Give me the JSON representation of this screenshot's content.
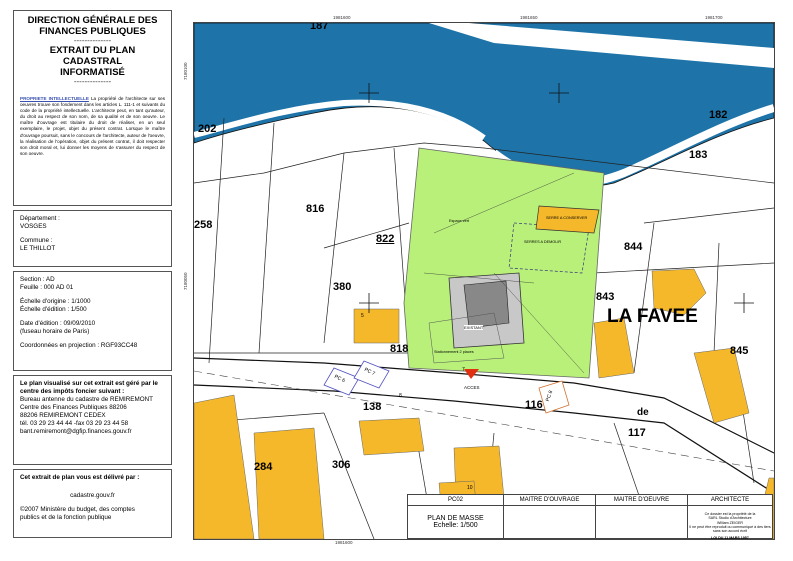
{
  "sidebar": {
    "header": {
      "line1": "DIRECTION GÉNÉRALE DES",
      "line2": "FINANCES PUBLIQUES",
      "dash": "--------------",
      "line3": "EXTRAIT DU PLAN CADASTRAL",
      "line4": "INFORMATISÉ",
      "dash2": "--------------"
    },
    "property": {
      "title": "PROPRIETE INTELLECTUELLE",
      "text": "La propriété de l'architecte sur ses oeuvres trouve son fondement dans les articles L. 111-1 et suivants du code de la propriété intellectuelle. L'architecte peut, en tant qu'auteur, du droit au respect de son nom, de sa qualité et de son oeuvre. Le maître d'ouvrage est titulaire du droit de réaliser, en un seul exemplaire, le projet, objet du présent contrat. Lorsque le maître d'ouvrage poursuit, sans le concours de l'architecte, auteur de l'oeuvre, la réalisation de l'opération, objet du présent contrat, il doit respecter son droit moral et, lui donner les moyens de s'assurer du respect de son oeuvre."
    },
    "location": {
      "dept_label": "Département :",
      "dept_value": "VOSGES",
      "commune_label": "Commune :",
      "commune_value": "LE THILLOT"
    },
    "section": {
      "section": "Section : AD",
      "feuille": "Feuille : 000 AD 01",
      "echelle_origine": "Échelle d'origine : 1/1000",
      "echelle_edition": "Échelle d'édition : 1/500",
      "date_label": "Date d'édition : 09/09/2010",
      "date_tz": "(fuseau horaire de Paris)",
      "coords": "Coordonnées en projection : RGF93CC48"
    },
    "centre": {
      "l1": "Le plan visualisé sur cet extrait est géré par le",
      "l2": "centre des impôts foncier suivant :",
      "l3": "Bureau antenne du cadastre de REMIREMONT",
      "l4": "Centre des Finances Publiques  88206",
      "l5": "88206 REMIREMONT CEDEX",
      "l6": "tél. 03 29 23 44 44 -fax 03 29 23 44 58",
      "l7": "bant.remiremont@dgfip.finances.gouv.fr"
    },
    "footer": {
      "l1": "Cet extrait de plan vous est délivré par :",
      "l2": "cadastre.gouv.fr",
      "l3": "©2007 Ministère du budget, des comptes",
      "l4": "publics et de la fonction publique"
    }
  },
  "map": {
    "coords_top": [
      "1981600",
      "1981650",
      "1981700"
    ],
    "coords_left": [
      "7180100",
      "7180050"
    ],
    "coord_bottom": "1981600",
    "parcels": [
      "187",
      "202",
      "182",
      "183",
      "258",
      "816",
      "822",
      "844",
      "380",
      "843",
      "845",
      "818",
      "138",
      "116",
      "117",
      "284",
      "306",
      "5",
      "8",
      "10",
      "7"
    ],
    "place_name": "LA FAVEE",
    "road_fragment": "de",
    "pc_labels": [
      "PC 6",
      "PC 7",
      "PC 8"
    ],
    "acces": "ACCES",
    "site_labels": [
      "Espace vert",
      "EXISTANT",
      "SERRES A DEMOLIR",
      "SERRE A CONSERVER",
      "Stationnement 2 places"
    ],
    "colors": {
      "garden": "#b8f07a",
      "building": "#f5b82a",
      "river": "#1e74a8"
    }
  },
  "title_block": {
    "pc": "PC02",
    "maitre_ouvrage": "MAITRE D'OUVRAGE",
    "maitre_oeuvre": "MAITRE D'OEUVRE",
    "architecte": "ARCHITECTE",
    "plan_title": "PLAN DE MASSE",
    "plan_scale": "Echelle: 1/500",
    "arch_note1": "Ce dossier est la propriété de la",
    "arch_note2": "SARL Studio d'Architecture",
    "arch_note3": "William ZEIGER",
    "arch_note4": "Il ne peut être reproduit ou communiqué à des tiers",
    "arch_note5": "sans son accord écrit",
    "arch_note6": "LOI DU 11 MARS 1957"
  }
}
